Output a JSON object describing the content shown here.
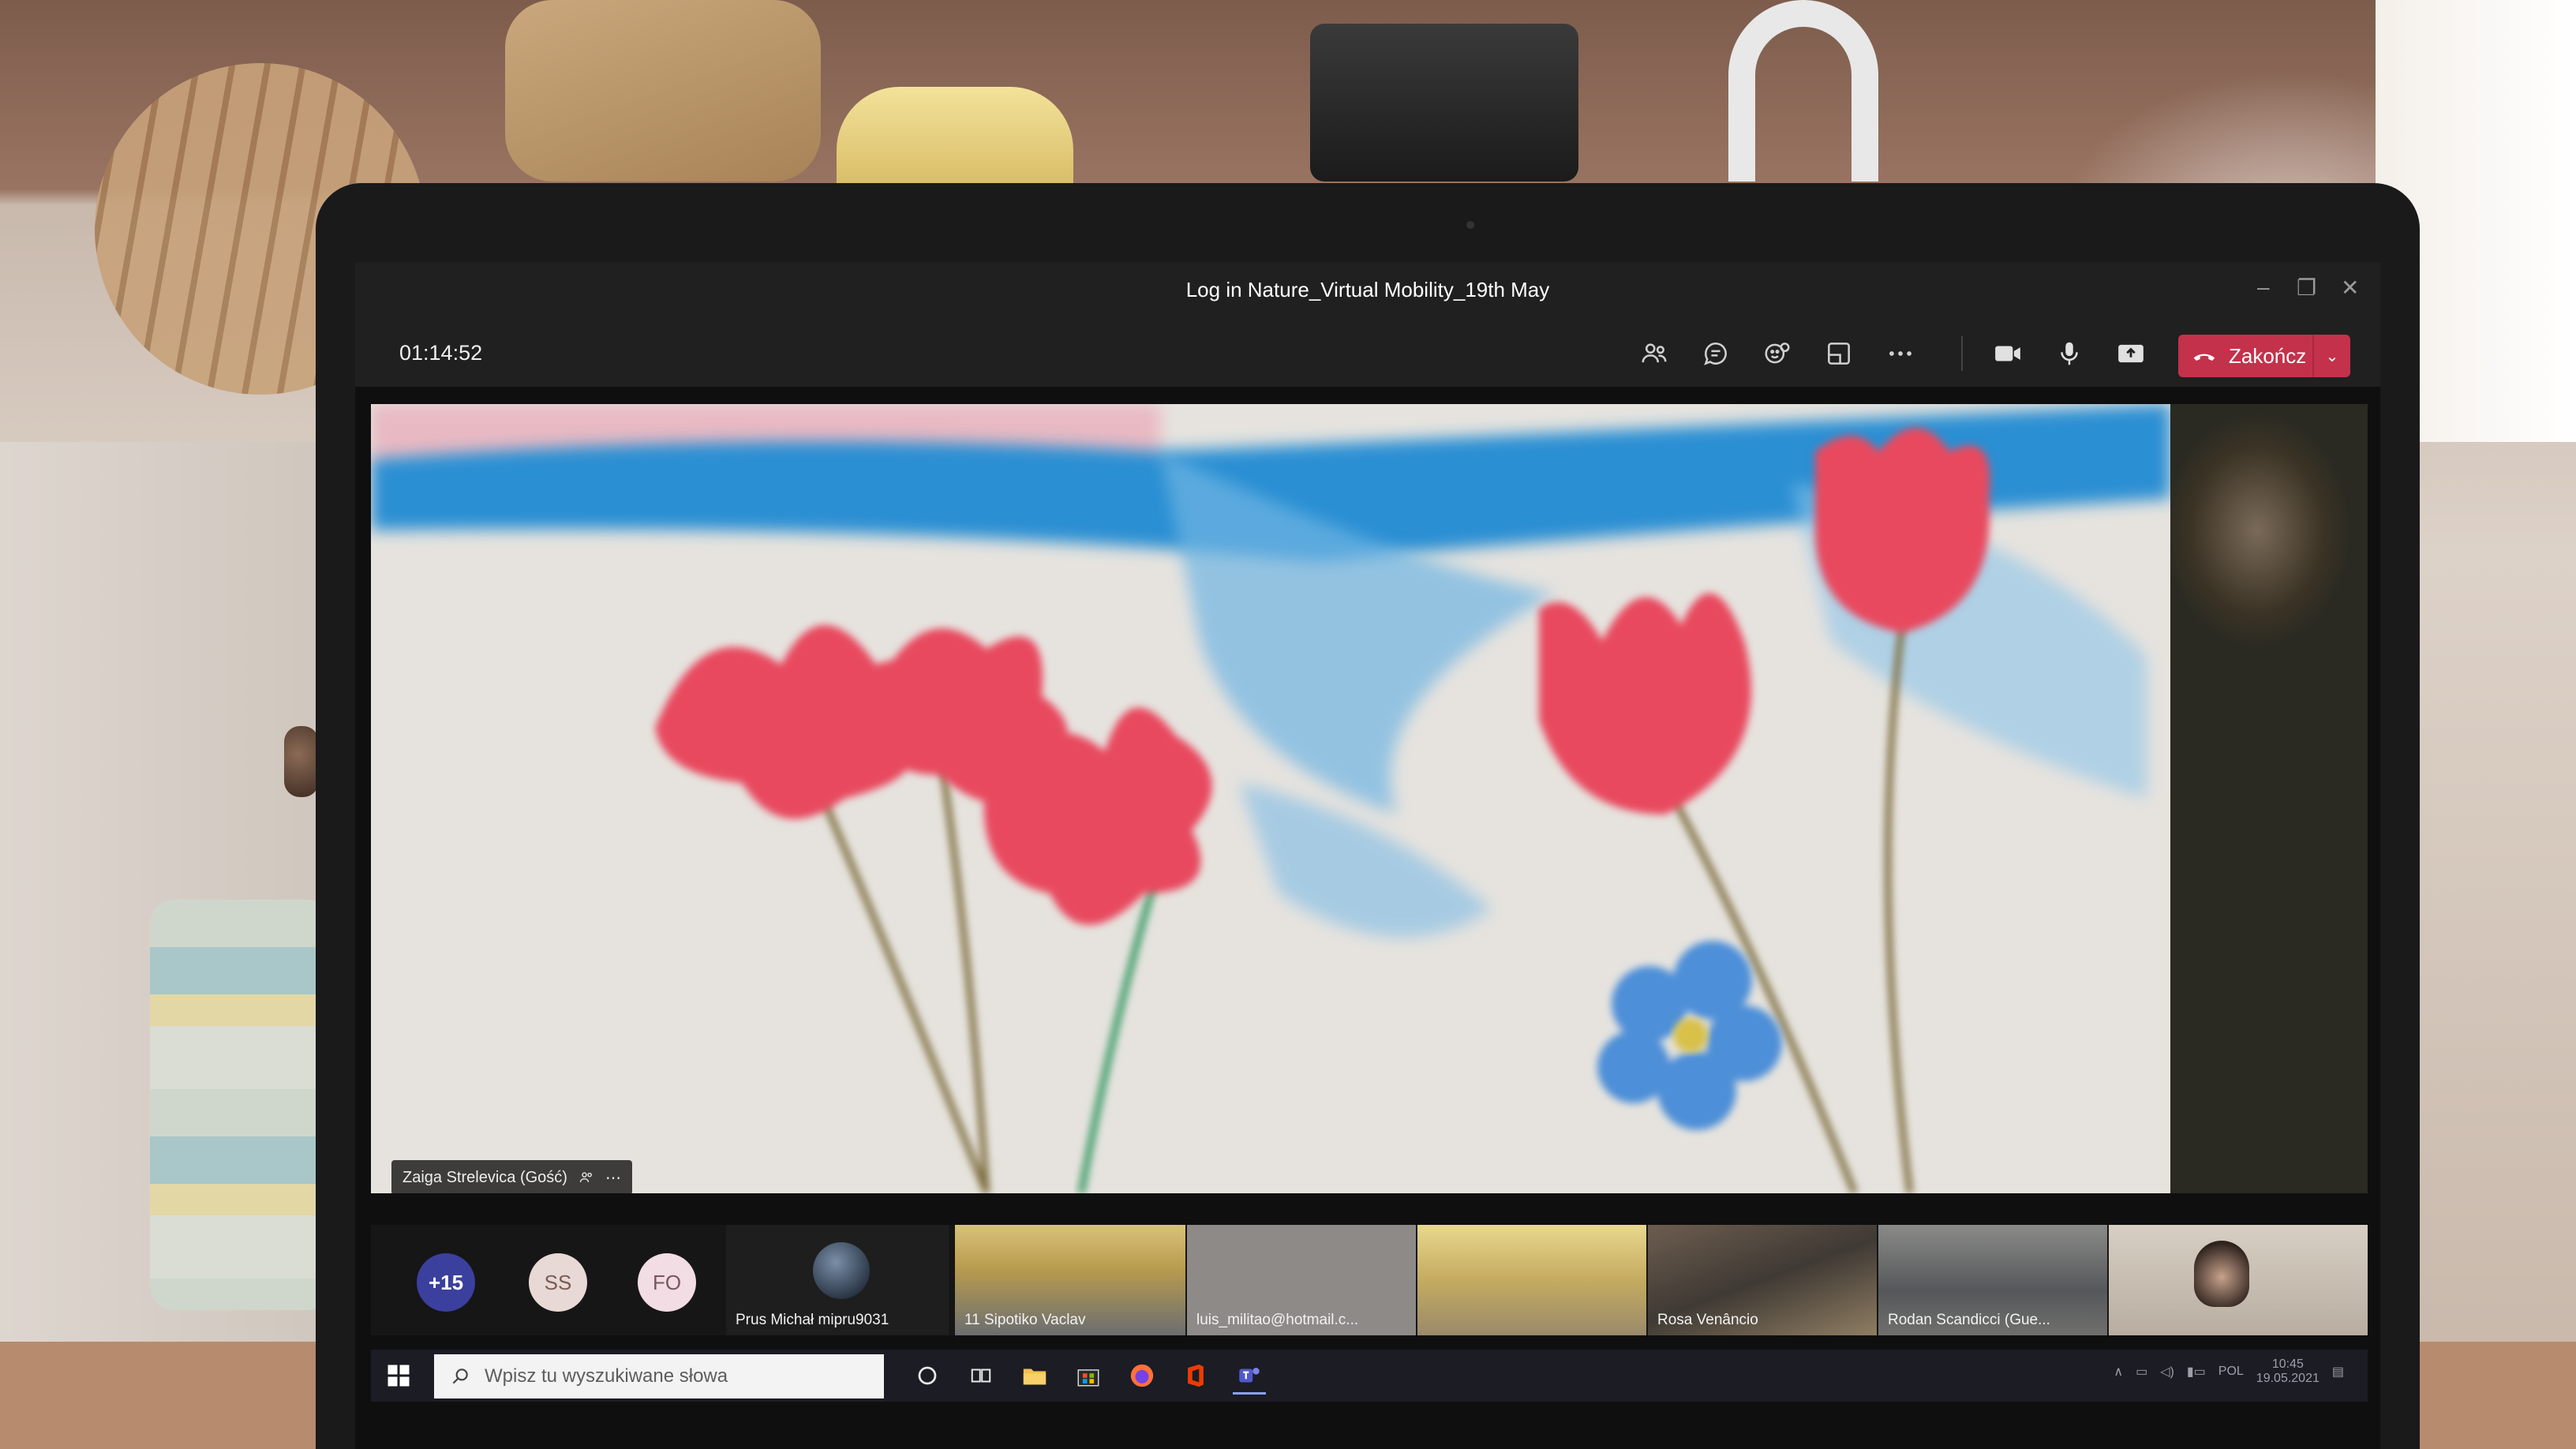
{
  "window": {
    "title": "Log in Nature_Virtual Mobility_19th May",
    "minimize": "–",
    "restore": "❐",
    "close": "✕"
  },
  "meeting": {
    "timer": "01:14:52",
    "end_button_label": "Zakończ",
    "end_dropdown": "⌄"
  },
  "main_video": {
    "presenter_name": "Zaiga Strelevica (Gość)",
    "more": "⋯"
  },
  "participants": {
    "overflow_count": "+15",
    "avatars": [
      "SS",
      "FO"
    ],
    "tiles": [
      {
        "label": "Prus Michał mipru9031"
      },
      {
        "label": "11 Sipotiko Vaclav"
      },
      {
        "label": "luis_militao@hotmail.c..."
      },
      {
        "label": ""
      },
      {
        "label": "Rosa Venâncio"
      },
      {
        "label": "Rodan Scandicci (Gue..."
      },
      {
        "label": ""
      }
    ]
  },
  "taskbar": {
    "search_placeholder": "Wpisz tu wyszukiwane słowa",
    "language": "POL",
    "time": "10:45",
    "date": "19.05.2021"
  },
  "colors": {
    "teams_dark": "#202020",
    "end_call_red": "#c4314b",
    "overflow_avatar": "#3b3f9e"
  }
}
